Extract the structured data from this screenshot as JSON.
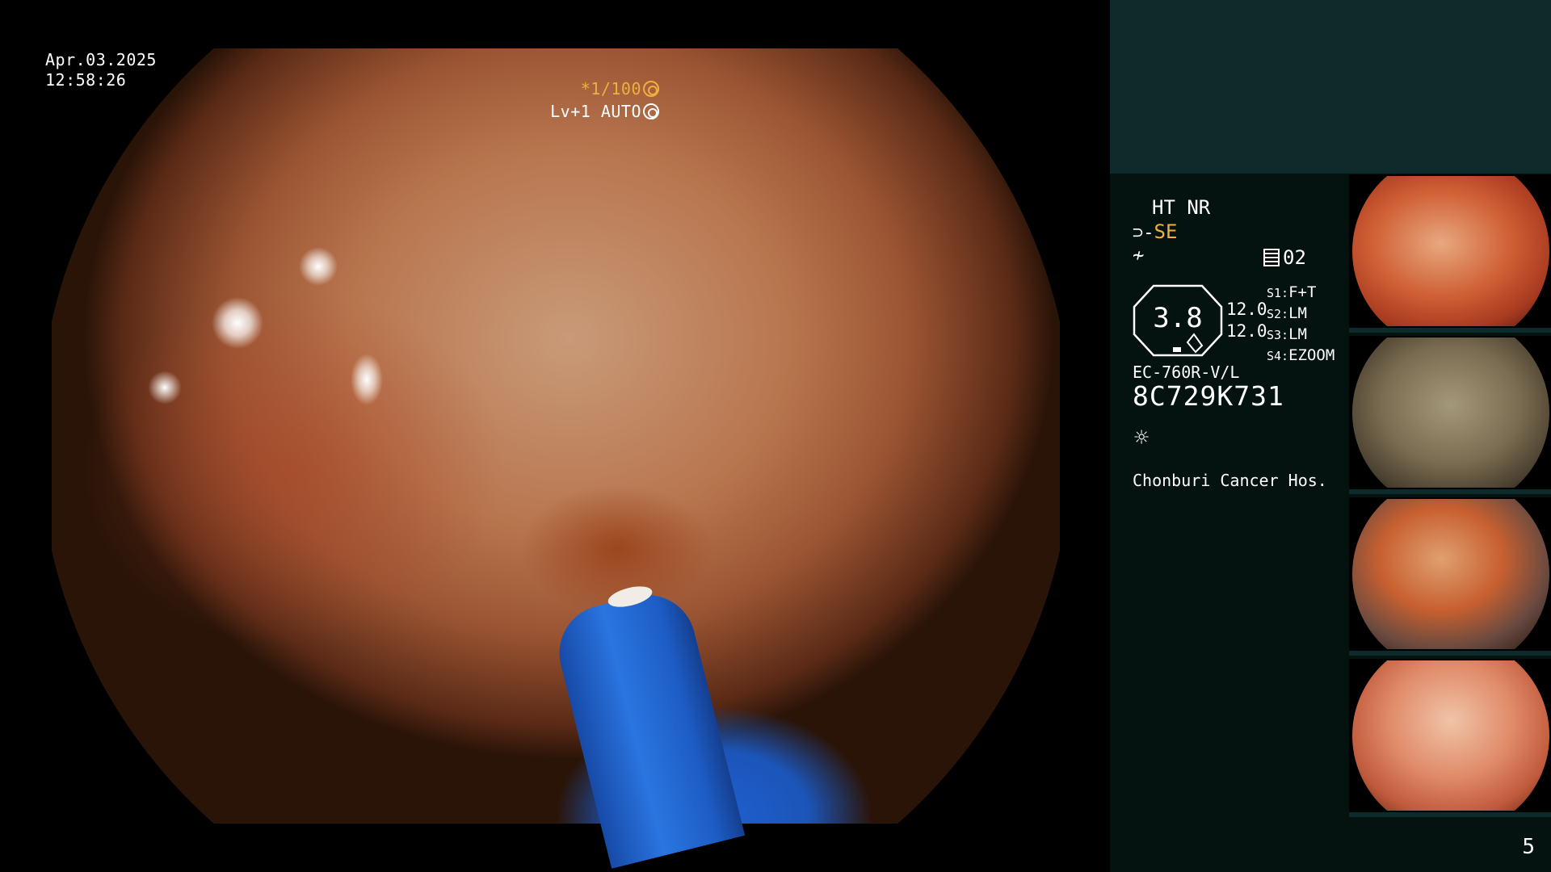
{
  "overlay": {
    "date": "Apr.03.2025",
    "time": "12:58:26",
    "shutter": "*1/100",
    "level": "Lv+1 AUTO"
  },
  "panel": {
    "ht_nr": "HT NR",
    "se_icon": "⊃-",
    "se": "SE",
    "eq_icon": "≁",
    "channel": "02",
    "zoom_value": "3.8",
    "values": [
      "12.0",
      "12.0"
    ],
    "sets": [
      {
        "key": "S1:",
        "val": "F+T"
      },
      {
        "key": "S2:",
        "val": "LM"
      },
      {
        "key": "S3:",
        "val": "LM"
      },
      {
        "key": "S4:",
        "val": "EZOOM"
      }
    ],
    "model": "EC-760R-V/L",
    "serial": "8C729K731",
    "lamp_icon": "☼",
    "hospital": "Chonburi Cancer Hos.",
    "page_number": "5"
  },
  "colors": {
    "panel_bg": "#041210",
    "panel_top": "#0e2a2a",
    "accent": "#f0b040"
  }
}
